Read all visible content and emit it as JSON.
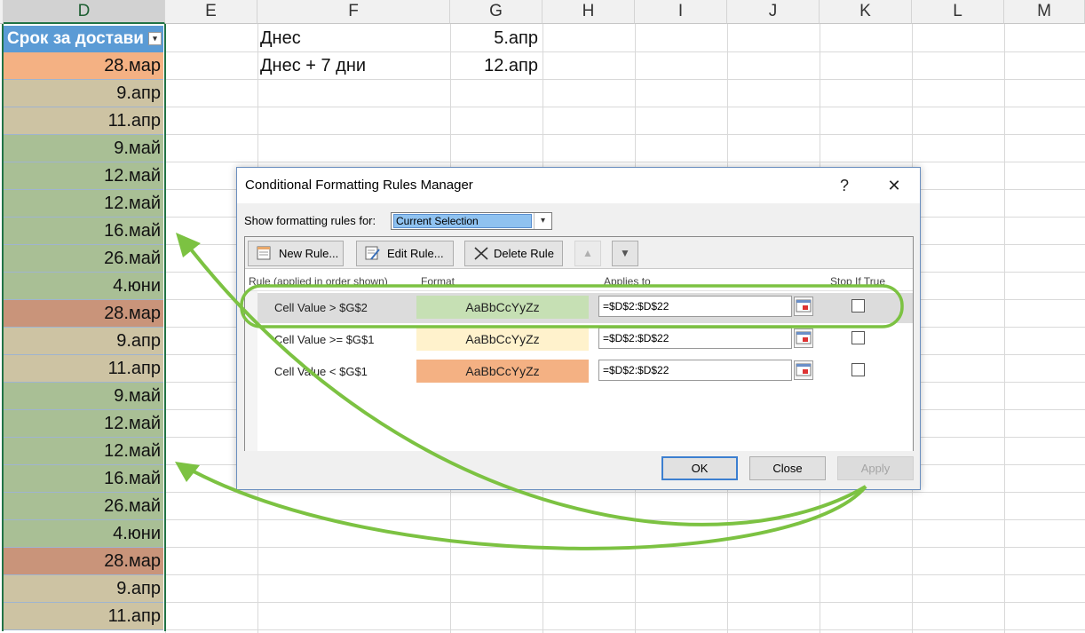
{
  "spreadsheet": {
    "columns": [
      "D",
      "E",
      "F",
      "G",
      "H",
      "I",
      "J",
      "K",
      "L",
      "M"
    ],
    "table_header": "Срок за достави",
    "d_values": [
      "28.мар",
      "9.апр",
      "11.апр",
      "9.май",
      "12.май",
      "12.май",
      "16.май",
      "26.май",
      "4.юни",
      "28.мар",
      "9.апр",
      "11.апр",
      "9.май",
      "12.май",
      "12.май",
      "16.май",
      "26.май",
      "4.юни",
      "28.мар",
      "9.апр",
      "11.апр"
    ],
    "d_colors": [
      "#f4b183",
      "#cdc3a3",
      "#cdc3a3",
      "#a9bf95",
      "#a9bf95",
      "#a9bf95",
      "#a9bf95",
      "#a9bf95",
      "#a9bf95",
      "#c9947a",
      "#cdc3a3",
      "#cdc3a3",
      "#a9bf95",
      "#a9bf95",
      "#a9bf95",
      "#a9bf95",
      "#a9bf95",
      "#a9bf95",
      "#c9947a",
      "#cdc3a3",
      "#cdc3a3"
    ],
    "f2": "Днес",
    "g2": "5.апр",
    "f3": "Днес + 7 дни",
    "g3": "12.апр"
  },
  "dialog": {
    "title": "Conditional Formatting Rules Manager",
    "help_glyph": "?",
    "close_glyph": "✕",
    "show_label": "Show formatting rules for:",
    "show_value": "Current Selection",
    "new_rule": "New Rule...",
    "edit_rule": "Edit Rule...",
    "delete_rule": "Delete Rule",
    "move_up": "▲",
    "move_down": "▼",
    "col_rule": "Rule (applied in order shown)",
    "col_format": "Format",
    "col_applies": "Applies to",
    "col_stop": "Stop If True",
    "rules": [
      {
        "name": "Cell Value > $G$2",
        "preview": "AaBbCcYyZz",
        "color": "#c6e0b4",
        "applies_to": "=$D$2:$D$22"
      },
      {
        "name": "Cell Value >= $G$1",
        "preview": "AaBbCcYyZz",
        "color": "#fff2cc",
        "applies_to": "=$D$2:$D$22"
      },
      {
        "name": "Cell Value < $G$1",
        "preview": "AaBbCcYyZz",
        "color": "#f4b183",
        "applies_to": "=$D$2:$D$22"
      }
    ],
    "ok": "OK",
    "close": "Close",
    "apply": "Apply"
  },
  "colors": {
    "annotation_green": "#7cc242",
    "table_header_blue": "#5b9bd5",
    "excel_green": "#217346"
  }
}
